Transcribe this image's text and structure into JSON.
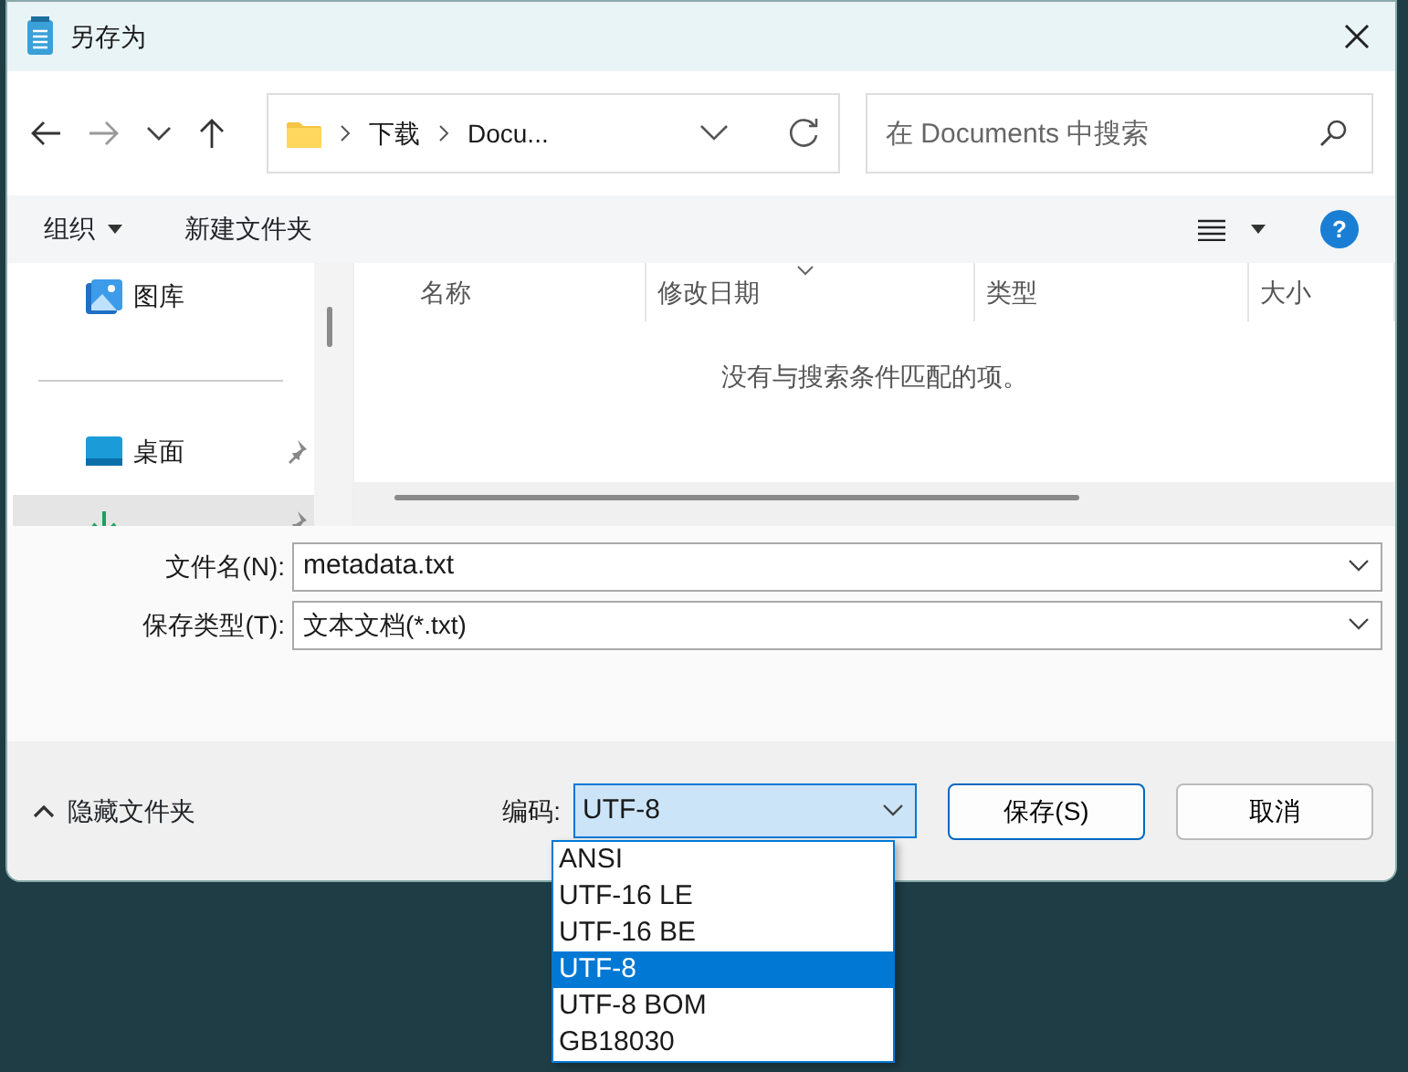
{
  "window": {
    "title": "另存为"
  },
  "navigation": {
    "breadcrumb": [
      "下载",
      "Docu..."
    ],
    "search": {
      "placeholder": "在 Documents 中搜索"
    }
  },
  "toolbar": {
    "organize": "组织",
    "new_folder": "新建文件夹",
    "help": "?"
  },
  "sidebar": {
    "items": [
      {
        "label": "图库",
        "kind": "gallery",
        "pinned": false,
        "selected": false
      },
      {
        "label": "桌面",
        "kind": "desktop",
        "pinned": true,
        "selected": false
      },
      {
        "kind": "downloads",
        "pinned": true,
        "selected": true
      }
    ]
  },
  "file_list": {
    "columns": [
      "名称",
      "修改日期",
      "类型",
      "大小"
    ],
    "empty_message": "没有与搜索条件匹配的项。"
  },
  "form": {
    "file_name": {
      "label": "文件名(N):",
      "value": "metadata.txt"
    },
    "file_type": {
      "label": "保存类型(T):",
      "value": "文本文档(*.txt)"
    }
  },
  "footer": {
    "hide_folders": "隐藏文件夹",
    "encoding": {
      "label": "编码:",
      "value": "UTF-8",
      "expanded": true,
      "options": [
        {
          "label": "ANSI",
          "selected": false
        },
        {
          "label": "UTF-16 LE",
          "selected": false
        },
        {
          "label": "UTF-16 BE",
          "selected": false
        },
        {
          "label": "UTF-8",
          "selected": true
        },
        {
          "label": "UTF-8 BOM",
          "selected": false
        },
        {
          "label": "GB18030",
          "selected": false
        }
      ]
    },
    "buttons": [
      {
        "label": "保存(S)",
        "kind": "primary"
      },
      {
        "label": "取消",
        "kind": "secondary"
      }
    ]
  }
}
